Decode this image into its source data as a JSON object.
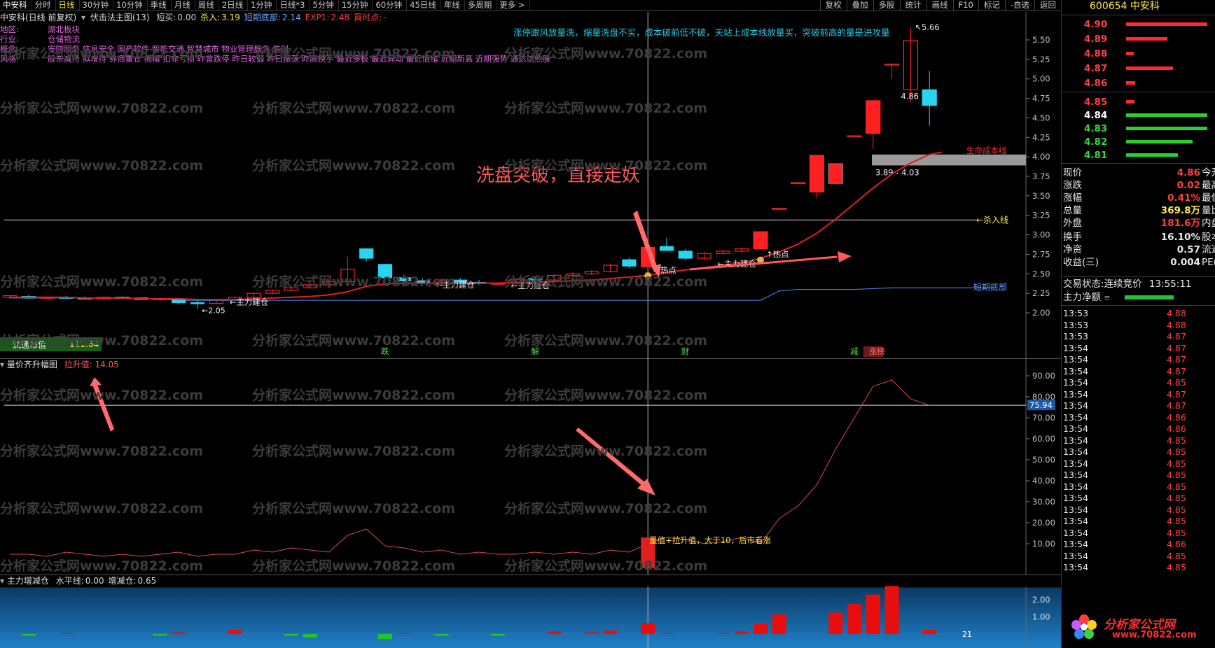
{
  "toolbar": {
    "stock_name": "中安科",
    "periods": [
      "分时",
      "日线",
      "30分钟",
      "10分钟",
      "季线",
      "月线",
      "周线",
      "2日线",
      "1分钟",
      "日线*3",
      "5分钟",
      "15分钟",
      "60分钟",
      "45日线",
      "年线",
      "多周期",
      "更多 >"
    ],
    "active_period_index": 1,
    "right_buttons": [
      "复权",
      "叠加",
      "多股",
      "统计",
      "画线",
      "F10",
      "标记",
      "-自选",
      "返回"
    ]
  },
  "main_chart": {
    "title": "中安科(日线 前复权)",
    "indicator_name": "伏击法主图(13)",
    "params": [
      {
        "label": "短买:",
        "value": "0.00",
        "color": "#c8c8c8"
      },
      {
        "label": "杀入:",
        "value": "3.19",
        "color": "#ffe94d"
      },
      {
        "label": "短期底部:",
        "value": "2.14",
        "color": "#6aa6ff"
      },
      {
        "label": "EXP1:",
        "value": "2.48",
        "color": "#ff3b3b"
      },
      {
        "label": "買时点:",
        "value": "-",
        "color": "#ff3b3b"
      }
    ],
    "info_rows": [
      {
        "label": "地区:",
        "value": "湖北板块"
      },
      {
        "label": "行业:",
        "value": "仓储物流"
      },
      {
        "label": "概念:",
        "value": "安防服务 信息安全 国产软件 智能交通 智慧城市 物业管理概念 信创"
      },
      {
        "label": "风格:",
        "value": "股东减持 拟增持 券商重仓 揭帽 扣非亏损 昨曾跌停 昨日较弱 昨日振荡 昨高换手 最近多板 最近异动 最近情绪 近期新高 近期强势 通达信热股"
      }
    ],
    "headline": "涨停跟风放量洗，缩量洗盘不买，成本破前低不破，天站上成本线放量买，突破前高的量是进攻量",
    "annotation": "洗盘突破，直接走妖",
    "y_ticks": [
      "5.50",
      "5.25",
      "5.00",
      "4.75",
      "4.50",
      "4.25",
      "4.00",
      "3.75",
      "3.50",
      "3.25",
      "3.00",
      "2.75",
      "2.50",
      "2.25",
      "2.00"
    ],
    "price_high": "5.66",
    "last_close_label": "4.86",
    "zone_label": "3.89 - 4.03",
    "life_line_label": "生命成本线",
    "kill_line_label": "杀入线",
    "short_bottom_label": "短期底部",
    "low_label": "2.05",
    "hot_label": "热点",
    "build_label": "←主力建仓",
    "float_mv_label": "流通市值",
    "float_mv_value": "111.64",
    "bottom_marks": [
      "跌",
      "解",
      "财",
      "减",
      "涨榜"
    ]
  },
  "chart_data": {
    "type": "candlestick",
    "y_range": [
      2.0,
      5.6
    ],
    "candles": [
      {
        "o": 2.2,
        "h": 2.23,
        "l": 2.18,
        "c": 2.22
      },
      {
        "o": 2.21,
        "h": 2.23,
        "l": 2.18,
        "c": 2.19
      },
      {
        "o": 2.19,
        "h": 2.21,
        "l": 2.17,
        "c": 2.2
      },
      {
        "o": 2.2,
        "h": 2.22,
        "l": 2.18,
        "c": 2.19
      },
      {
        "o": 2.19,
        "h": 2.21,
        "l": 2.17,
        "c": 2.18
      },
      {
        "o": 2.18,
        "h": 2.21,
        "l": 2.17,
        "c": 2.2
      },
      {
        "o": 2.2,
        "h": 2.21,
        "l": 2.18,
        "c": 2.19
      },
      {
        "o": 2.19,
        "h": 2.2,
        "l": 2.16,
        "c": 2.17
      },
      {
        "o": 2.17,
        "h": 2.19,
        "l": 2.15,
        "c": 2.18
      },
      {
        "o": 2.18,
        "h": 2.19,
        "l": 2.11,
        "c": 2.13
      },
      {
        "o": 2.13,
        "h": 2.16,
        "l": 2.05,
        "c": 2.12
      },
      {
        "o": 2.12,
        "h": 2.18,
        "l": 2.11,
        "c": 2.17
      },
      {
        "o": 2.17,
        "h": 2.21,
        "l": 2.16,
        "c": 2.2
      },
      {
        "o": 2.2,
        "h": 2.26,
        "l": 2.19,
        "c": 2.25
      },
      {
        "o": 2.25,
        "h": 2.3,
        "l": 2.24,
        "c": 2.29
      },
      {
        "o": 2.29,
        "h": 2.35,
        "l": 2.28,
        "c": 2.32
      },
      {
        "o": 2.32,
        "h": 2.38,
        "l": 2.31,
        "c": 2.36
      },
      {
        "o": 2.36,
        "h": 2.42,
        "l": 2.34,
        "c": 2.4
      },
      {
        "o": 2.4,
        "h": 2.72,
        "l": 2.4,
        "c": 2.56
      },
      {
        "o": 2.82,
        "h": 2.83,
        "l": 2.66,
        "c": 2.7
      },
      {
        "o": 2.62,
        "h": 2.63,
        "l": 2.43,
        "c": 2.45
      },
      {
        "o": 2.45,
        "h": 2.49,
        "l": 2.38,
        "c": 2.41
      },
      {
        "o": 2.41,
        "h": 2.44,
        "l": 2.37,
        "c": 2.39
      },
      {
        "o": 2.39,
        "h": 2.44,
        "l": 2.36,
        "c": 2.42
      },
      {
        "o": 2.42,
        "h": 2.45,
        "l": 2.37,
        "c": 2.39
      },
      {
        "o": 2.39,
        "h": 2.42,
        "l": 2.36,
        "c": 2.38
      },
      {
        "o": 2.37,
        "h": 2.39,
        "l": 2.35,
        "c": 2.38
      },
      {
        "o": 2.38,
        "h": 2.44,
        "l": 2.37,
        "c": 2.43
      },
      {
        "o": 2.44,
        "h": 2.47,
        "l": 2.4,
        "c": 2.42
      },
      {
        "o": 2.42,
        "h": 2.5,
        "l": 2.41,
        "c": 2.48
      },
      {
        "o": 2.48,
        "h": 2.52,
        "l": 2.46,
        "c": 2.5
      },
      {
        "o": 2.5,
        "h": 2.55,
        "l": 2.48,
        "c": 2.53
      },
      {
        "o": 2.53,
        "h": 2.63,
        "l": 2.52,
        "c": 2.61
      },
      {
        "o": 2.68,
        "h": 2.71,
        "l": 2.57,
        "c": 2.6
      },
      {
        "o": 2.59,
        "h": 2.86,
        "l": 2.58,
        "c": 2.84
      },
      {
        "o": 2.85,
        "h": 2.96,
        "l": 2.8,
        "c": 2.8
      },
      {
        "o": 2.79,
        "h": 2.82,
        "l": 2.68,
        "c": 2.7
      },
      {
        "o": 2.7,
        "h": 2.78,
        "l": 2.68,
        "c": 2.76
      },
      {
        "o": 2.76,
        "h": 2.8,
        "l": 2.74,
        "c": 2.79
      },
      {
        "o": 2.79,
        "h": 2.84,
        "l": 2.77,
        "c": 2.82
      },
      {
        "o": 2.82,
        "h": 3.04,
        "l": 2.82,
        "c": 3.04
      },
      {
        "o": 3.34,
        "h": 3.35,
        "l": 3.33,
        "c": 3.34
      },
      {
        "o": 3.67,
        "h": 3.68,
        "l": 3.66,
        "c": 3.67
      },
      {
        "o": 3.55,
        "h": 4.02,
        "l": 3.47,
        "c": 4.02
      },
      {
        "o": 3.91,
        "h": 3.91,
        "l": 3.65,
        "c": 3.66
      },
      {
        "o": 4.27,
        "h": 4.28,
        "l": 4.26,
        "c": 4.27
      },
      {
        "o": 4.3,
        "h": 4.73,
        "l": 4.1,
        "c": 4.72
      },
      {
        "o": 5.19,
        "h": 5.19,
        "l": 5.0,
        "c": 5.19
      },
      {
        "o": 4.86,
        "h": 5.66,
        "l": 4.7,
        "c": 5.49
      },
      {
        "o": 4.86,
        "h": 5.1,
        "l": 4.4,
        "c": 4.66
      }
    ],
    "exp1_line": [
      2.2,
      2.2,
      2.2,
      2.2,
      2.19,
      2.19,
      2.19,
      2.18,
      2.18,
      2.18,
      2.17,
      2.17,
      2.17,
      2.18,
      2.19,
      2.2,
      2.21,
      2.23,
      2.27,
      2.34,
      2.37,
      2.38,
      2.38,
      2.38,
      2.38,
      2.38,
      2.38,
      2.39,
      2.39,
      2.4,
      2.41,
      2.42,
      2.44,
      2.46,
      2.48,
      2.52,
      2.55,
      2.58,
      2.61,
      2.64,
      2.7,
      2.78,
      2.88,
      3.02,
      3.2,
      3.4,
      3.6,
      3.78,
      3.92,
      4.03
    ],
    "short_bottom_line": [
      2.19,
      2.19,
      2.19,
      2.19,
      2.19,
      2.19,
      2.19,
      2.18,
      2.18,
      2.16,
      2.16,
      2.16,
      2.16,
      2.16,
      2.16,
      2.16,
      2.16,
      2.16,
      2.16,
      2.16,
      2.16,
      2.16,
      2.16,
      2.16,
      2.16,
      2.16,
      2.16,
      2.16,
      2.16,
      2.16,
      2.16,
      2.16,
      2.16,
      2.16,
      2.16,
      2.16,
      2.16,
      2.16,
      2.16,
      2.16,
      2.16,
      2.28,
      2.3,
      2.3,
      2.3,
      2.3,
      2.31,
      2.32,
      2.32,
      2.32
    ],
    "kill_line": 3.19,
    "zone_band": [
      3.89,
      4.03
    ],
    "sub1": {
      "title": "量价齐升幅图",
      "param_label": "拉升值:",
      "param_value": "14.05",
      "y_ticks": [
        "90.00",
        "80.00",
        "70.00",
        "60.00",
        "50.00",
        "40.00",
        "30.00",
        "20.00",
        "10.00"
      ],
      "y_range": [
        0,
        95
      ],
      "cur_label": "75.94",
      "annotation": "量值+拉升值，大于10，后市看涨",
      "line": [
        5,
        5,
        4,
        6,
        5,
        4,
        5,
        4,
        5,
        6,
        4,
        5,
        5,
        7,
        6,
        8,
        7,
        6,
        14,
        17,
        9,
        8,
        6,
        7,
        5,
        6,
        5,
        5,
        6,
        5,
        6,
        5,
        7,
        6,
        10,
        13,
        12,
        10,
        11,
        13,
        10,
        22,
        28,
        38,
        55,
        70,
        85,
        88,
        79,
        75.94
      ]
    },
    "sub2": {
      "title": "主力增减仓",
      "params": [
        {
          "label": "水平线:",
          "value": "0.00"
        },
        {
          "label": "增减仓:",
          "value": "0.65"
        }
      ],
      "y_ticks": [
        "2.00",
        "1.00"
      ],
      "y_range": [
        -0.4,
        3.0
      ],
      "bars": [
        0,
        -0.1,
        0,
        0.05,
        0,
        0,
        0,
        0,
        -0.1,
        0.1,
        0,
        0,
        0.25,
        0,
        0,
        -0.1,
        -0.2,
        0,
        0,
        0,
        -0.3,
        0.05,
        0,
        -0.1,
        0,
        0,
        -0.1,
        0,
        0,
        0.15,
        0,
        0.1,
        0.2,
        0,
        0.65,
        0.05,
        0,
        0,
        0.05,
        0.15,
        0.6,
        1.15,
        0,
        0,
        1.25,
        1.75,
        2.3,
        2.8,
        0,
        0.25
      ],
      "end_label": "21"
    },
    "colors": {
      "up": "#ff2020",
      "down": "#2ad3f0",
      "exp1": "#e02020",
      "bottom": "#4a7bd0"
    }
  },
  "sidebar": {
    "code": "600654",
    "name": "中安科",
    "asks": [
      {
        "price": "4.90",
        "bar": 0.95
      },
      {
        "price": "4.89",
        "bar": 0.48
      },
      {
        "price": "4.88",
        "bar": 0.09
      },
      {
        "price": "4.87",
        "bar": 0.55
      },
      {
        "price": "4.86",
        "bar": 0.11
      }
    ],
    "bids": [
      {
        "price": "4.85",
        "bar": 0.1
      },
      {
        "price": "4.84",
        "bar": 0.95
      },
      {
        "price": "4.83",
        "bar": 0.95
      },
      {
        "price": "4.82",
        "bar": 0.78
      },
      {
        "price": "4.81",
        "bar": 0.61
      }
    ],
    "quote": [
      {
        "label": "现价",
        "value": "4.86",
        "vcolor": "#ff4040",
        "extra": "今开"
      },
      {
        "label": "涨跌",
        "value": "0.02",
        "vcolor": "#ff4040",
        "extra": "最高"
      },
      {
        "label": "涨幅",
        "value": "0.41%",
        "vcolor": "#ff4040",
        "extra": "最低"
      },
      {
        "label": "总量",
        "value": "369.8万",
        "vcolor": "#ffe94d",
        "extra": "量比"
      },
      {
        "label": "外盘",
        "value": "181.6万",
        "vcolor": "#ff4040",
        "extra": "内盘"
      },
      {
        "label": "换手",
        "value": "16.10%",
        "vcolor": "#e8e8e8",
        "extra": "股本"
      },
      {
        "label": "净资",
        "value": "0.57",
        "vcolor": "#e8e8e8",
        "extra": "流通"
      },
      {
        "label": "收益(三)",
        "value": "0.004",
        "vcolor": "#e8e8e8",
        "extra": "PE(动"
      }
    ],
    "trade_state_label": "交易状态:",
    "trade_state_value": "连续竞价",
    "trade_time": "13:55:11",
    "main_net_label": "主力净额",
    "trades": [
      {
        "t": "13:53",
        "p": "4.88"
      },
      {
        "t": "13:53",
        "p": "4.88"
      },
      {
        "t": "13:53",
        "p": "4.87"
      },
      {
        "t": "13:54",
        "p": "4.87"
      },
      {
        "t": "13:54",
        "p": "4.87"
      },
      {
        "t": "13:54",
        "p": "4.87"
      },
      {
        "t": "13:54",
        "p": "4.85"
      },
      {
        "t": "13:54",
        "p": "4.87"
      },
      {
        "t": "13:54",
        "p": "4.87"
      },
      {
        "t": "13:54",
        "p": "4.86"
      },
      {
        "t": "13:54",
        "p": "4.86"
      },
      {
        "t": "13:54",
        "p": "4.85"
      },
      {
        "t": "13:54",
        "p": "4.85"
      },
      {
        "t": "13:54",
        "p": "4.85"
      },
      {
        "t": "13:54",
        "p": "4.85"
      },
      {
        "t": "13:54",
        "p": "4.85"
      },
      {
        "t": "13:54",
        "p": "4.85"
      },
      {
        "t": "13:54",
        "p": "4.85"
      },
      {
        "t": "13:54",
        "p": "4.85"
      },
      {
        "t": "13:54",
        "p": "4.85"
      },
      {
        "t": "13:54",
        "p": "4.86"
      },
      {
        "t": "13:54",
        "p": "4.85"
      },
      {
        "t": "13:54",
        "p": "4.85"
      }
    ]
  },
  "watermark": {
    "text": "分析家公式网www.70822.com",
    "logo_name": "分析家公式网",
    "logo_url": "www.70822.com"
  }
}
